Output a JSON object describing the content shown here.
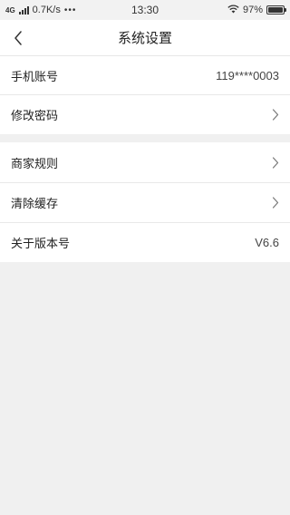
{
  "status_bar": {
    "network": "4G",
    "speed": "0.7K/s",
    "dots": "•••",
    "time": "13:30",
    "battery_percent": "97%",
    "battery_level": 0.97
  },
  "nav": {
    "title": "系统设置",
    "back_icon": "chevron-left-icon"
  },
  "settings": {
    "group1": [
      {
        "label": "手机账号",
        "value": "119****0003"
      },
      {
        "label": "修改密码",
        "icon": "chevron-right-icon"
      }
    ],
    "group2": [
      {
        "label": "商家规则",
        "icon": "chevron-right-icon"
      },
      {
        "label": "清除缓存",
        "icon": "chevron-right-icon"
      },
      {
        "label": "关于版本号",
        "value": "V6.6"
      }
    ]
  }
}
